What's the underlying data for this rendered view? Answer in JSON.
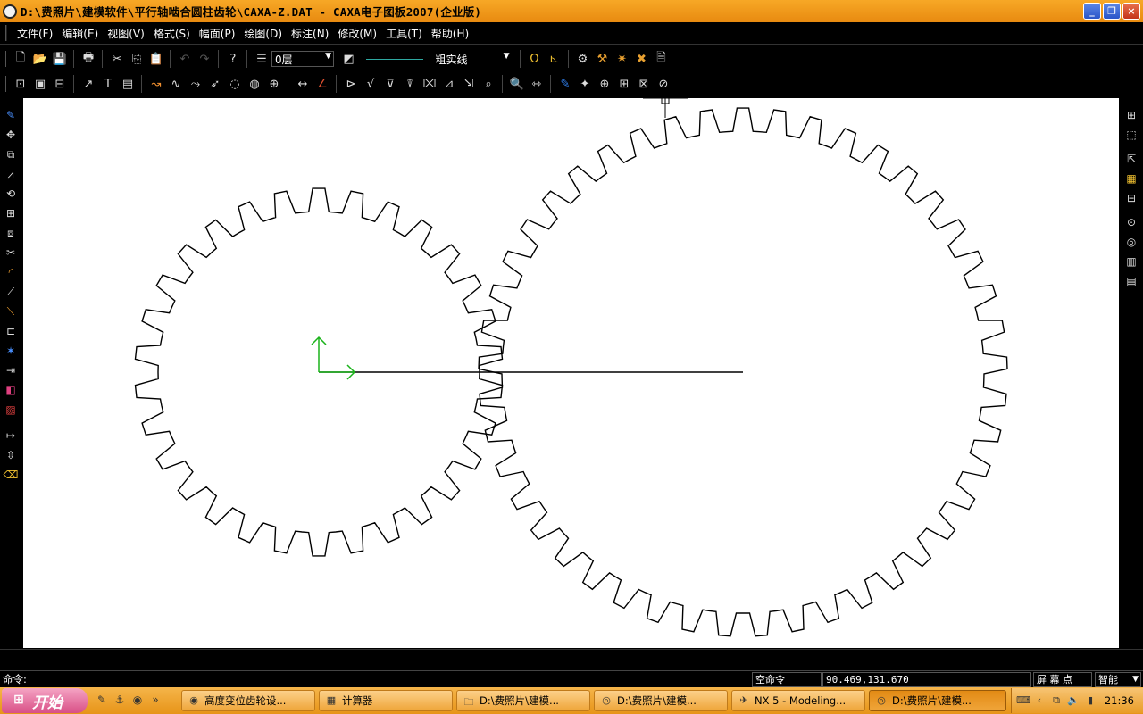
{
  "window": {
    "title": "D:\\费照片\\建模软件\\平行轴啮合圆柱齿轮\\CAXA-Z.DAT - CAXA电子图板2007(企业版)",
    "minimize": "_",
    "restore": "❐",
    "close": "×"
  },
  "menu": [
    "文件(F)",
    "编辑(E)",
    "视图(V)",
    "格式(S)",
    "幅面(P)",
    "绘图(D)",
    "标注(N)",
    "修改(M)",
    "工具(T)",
    "帮助(H)"
  ],
  "toolbar": {
    "layer": "0层",
    "linetype": "粗实线"
  },
  "statusbar": {
    "prompt": "命令:",
    "command": "空命令",
    "coords": "90.469,131.670",
    "snap": "屏 幕 点",
    "mode": "智能"
  },
  "taskbar": {
    "start": "开始",
    "tasks": [
      "高度变位齿轮设...",
      "计算器",
      "D:\\费照片\\建模...",
      "D:\\费照片\\建模...",
      "NX 5 - Modeling...",
      "D:\\费照片\\建模..."
    ],
    "clock": "21:36"
  },
  "colors": {
    "title_bar": "#f0a020",
    "canvas": "#ffffff",
    "gear_stroke": "#000000",
    "ucs_axis": "#00c000"
  },
  "icons": {
    "left_toolbar": [
      "pencil-icon",
      "move-icon",
      "copy-icon",
      "mirror-icon",
      "rotate-icon",
      "array-icon",
      "scale-icon",
      "trim-icon",
      "fillet-icon",
      "extend-icon",
      "break-icon",
      "chamfer-icon",
      "explode-icon",
      "stretch-icon",
      "color-icon",
      "hatch-icon",
      "dimension-icon",
      "align-icon",
      "eraser-icon"
    ],
    "right_toolbar": [
      "block-icon",
      "part-library-icon",
      "insert-icon",
      "view-icon",
      "section-icon",
      "detail-icon",
      "balloon-icon",
      "table-icon",
      "bom-icon"
    ]
  }
}
